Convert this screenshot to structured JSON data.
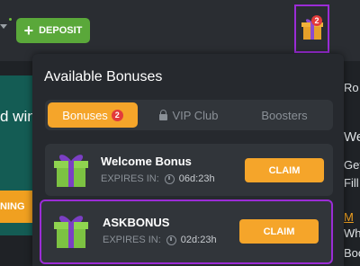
{
  "header": {
    "deposit_label": "DEPOSIT",
    "gift_badge_count": "2"
  },
  "background": {
    "left_text": "d win",
    "left_button_text": "NING",
    "right_texts": [
      "Ro",
      "We",
      "Get",
      "Fill",
      "M",
      "Wh",
      "Boo",
      "Pl",
      "me"
    ]
  },
  "panel": {
    "title": "Available Bonuses",
    "tabs": [
      {
        "label": "Bonuses",
        "count": "2"
      },
      {
        "label": "VIP Club"
      },
      {
        "label": "Boosters"
      }
    ],
    "cards": [
      {
        "name": "Welcome Bonus",
        "expires_label": "EXPIRES IN:",
        "time": "06d:23h",
        "claim_label": "CLAIM"
      },
      {
        "name": "ASKBONUS",
        "expires_label": "EXPIRES IN:",
        "time": "02d:23h",
        "claim_label": "CLAIM"
      }
    ]
  },
  "colors": {
    "accent": "#f5a52a",
    "deposit_green": "#5aa83a",
    "highlight_purple": "#9b2cd6",
    "badge_red": "#e23b3b"
  }
}
